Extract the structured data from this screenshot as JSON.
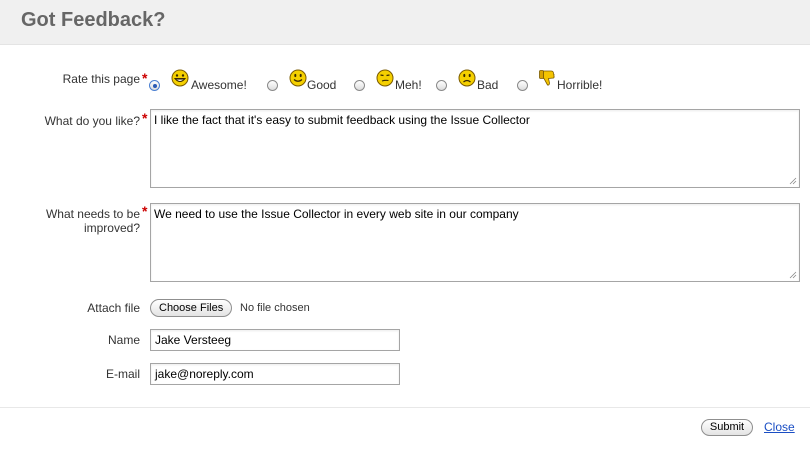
{
  "header": {
    "title": "Got Feedback?"
  },
  "form": {
    "rating": {
      "label": "Rate this page",
      "required_mark": "*",
      "options": [
        {
          "label": "Awesome!",
          "icon": "awesome-face-icon",
          "checked": true
        },
        {
          "label": "Good",
          "icon": "smile-face-icon",
          "checked": false
        },
        {
          "label": "Meh!",
          "icon": "meh-face-icon",
          "checked": false
        },
        {
          "label": "Bad",
          "icon": "sad-face-icon",
          "checked": false
        },
        {
          "label": "Horrible!",
          "icon": "thumbs-down-icon",
          "checked": false
        }
      ]
    },
    "like": {
      "label": "What do you like?",
      "required_mark": "*",
      "value": "I like the fact that it's easy to submit feedback using the Issue Collector"
    },
    "improve": {
      "label": "What needs to be improved?",
      "required_mark": "*",
      "value": "We need to use the Issue Collector in every web site in our company"
    },
    "attach": {
      "label": "Attach file",
      "button_label": "Choose Files",
      "status": "No file chosen"
    },
    "name": {
      "label": "Name",
      "value": "Jake Versteeg"
    },
    "email": {
      "label": "E-mail",
      "value": "jake@noreply.com"
    }
  },
  "footer": {
    "submit_label": "Submit",
    "close_label": "Close"
  },
  "colors": {
    "header_bg": "#f0f0f0",
    "title": "#666666",
    "required": "#cc0000",
    "link": "#1a4ec4",
    "face_yellow": "#f5d000"
  }
}
